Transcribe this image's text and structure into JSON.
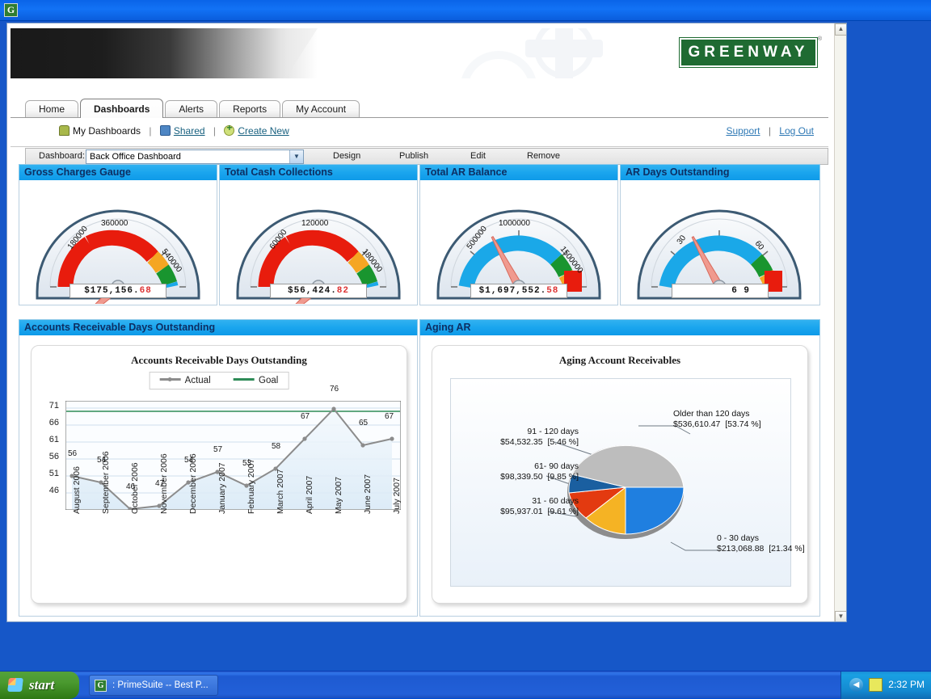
{
  "titlebar": {
    "favicon_letter": "G"
  },
  "banner": {
    "logo_text": "GREENWAY",
    "trademark": "®"
  },
  "tabs": [
    {
      "label": "Home",
      "active": false
    },
    {
      "label": "Dashboards",
      "active": true
    },
    {
      "label": "Alerts",
      "active": false
    },
    {
      "label": "Reports",
      "active": false
    },
    {
      "label": "My Account",
      "active": false
    }
  ],
  "subnav": {
    "my_dashboards": "My Dashboards",
    "shared": "Shared",
    "create_new": "Create New",
    "separator": "|",
    "support": "Support",
    "log_out": "Log Out"
  },
  "toolbar": {
    "dashboard_label": "Dashboard:",
    "selected_dashboard": "Back Office Dashboard",
    "chevron": "▼",
    "design": "Design",
    "publish": "Publish",
    "edit": "Edit",
    "remove": "Remove"
  },
  "gauges": [
    {
      "title": "Gross Charges Gauge",
      "value_main": "$175,156.",
      "value_cents": "68",
      "ticks": [
        "180000",
        "360000",
        "540000"
      ],
      "needle_deg": -42,
      "style": "forward",
      "bands": [
        {
          "color": "#e81c0d",
          "from": 0,
          "to": 0.62
        },
        {
          "color": "#f5a623",
          "from": 0.62,
          "to": 0.73
        },
        {
          "color": "#19952f",
          "from": 0.73,
          "to": 0.89
        },
        {
          "color": "#1aa8e8",
          "from": 0.89,
          "to": 1
        }
      ]
    },
    {
      "title": "Total Cash Collections",
      "value_main": "$56,424.",
      "value_cents": "82",
      "ticks": [
        "60000",
        "120000",
        "180000"
      ],
      "needle_deg": -42,
      "style": "forward",
      "bands": [
        {
          "color": "#e81c0d",
          "from": 0,
          "to": 0.62
        },
        {
          "color": "#f5a623",
          "from": 0.62,
          "to": 0.73
        },
        {
          "color": "#19952f",
          "from": 0.73,
          "to": 0.89
        },
        {
          "color": "#1aa8e8",
          "from": 0.89,
          "to": 1
        }
      ]
    },
    {
      "title": "Total AR Balance",
      "value_main": "$1,697,552.",
      "value_cents": "58",
      "ticks": [
        "500000",
        "1000000",
        "1500000"
      ],
      "needle_deg": 62,
      "style": "reverse",
      "bands": [
        {
          "color": "#1aa8e8",
          "from": 0,
          "to": 0.74
        },
        {
          "color": "#19952f",
          "from": 0.74,
          "to": 0.83
        },
        {
          "color": "#f5a623",
          "from": 0.83,
          "to": 0.89
        },
        {
          "color": "#e81c0d",
          "from": 0.89,
          "to": 1
        }
      ]
    },
    {
      "title": "AR Days Outstanding",
      "value_main": "6 9",
      "value_cents": "",
      "ticks": [
        "30",
        "60",
        ""
      ],
      "needle_deg": 62,
      "style": "reverse",
      "bands": [
        {
          "color": "#1aa8e8",
          "from": 0,
          "to": 0.74
        },
        {
          "color": "#19952f",
          "from": 0.74,
          "to": 0.83
        },
        {
          "color": "#f5a623",
          "from": 0.83,
          "to": 0.89
        },
        {
          "color": "#e81c0d",
          "from": 0.89,
          "to": 1
        }
      ]
    }
  ],
  "panels": {
    "ardo_header": "Accounts Receivable Days Outstanding",
    "aging_header": "Aging AR"
  },
  "chart_data": [
    {
      "type": "line",
      "title": "Accounts Receivable Days Outstanding",
      "xlabel": "",
      "ylabel": "",
      "ylim": [
        46,
        78
      ],
      "yticks": [
        46,
        51,
        56,
        61,
        66,
        71
      ],
      "grid": true,
      "legend_position": "top-center",
      "categories": [
        "August 2006",
        "September 2006",
        "October 2006",
        "November 2006",
        "December 2006",
        "January 2007",
        "February 2007",
        "March 2007",
        "April 2007",
        "May 2007",
        "June 2007",
        "July 2007"
      ],
      "series": [
        {
          "name": "Actual",
          "color": "#8c8c8c",
          "values": [
            56,
            54,
            46,
            47,
            54,
            57,
            53,
            58,
            67,
            76,
            65,
            67
          ]
        },
        {
          "name": "Goal",
          "color": "#2e8b57",
          "constant": 70
        }
      ]
    },
    {
      "type": "pie",
      "title": "Aging Account Receivables",
      "legend_position": "callout-labels",
      "slices": [
        {
          "label": "0 - 30 days",
          "amount": "$213,068.88",
          "percent_text": "[21.34 %]",
          "percent": 21.34,
          "color": "#1f7fe0"
        },
        {
          "label": "31 - 60 days",
          "amount": "$95,937.01",
          "percent_text": "[9.61 %]",
          "percent": 9.61,
          "color": "#f5b324"
        },
        {
          "label": "61- 90 days",
          "amount": "$98,339.50",
          "percent_text": "[9.85 %]",
          "percent": 9.85,
          "color": "#e33a10"
        },
        {
          "label": "91 - 120 days",
          "amount": "$54,532.35",
          "percent_text": "[5.46 %]",
          "percent": 5.46,
          "color": "#1a5fa0"
        },
        {
          "label": "Older than 120 days",
          "amount": "$536,610.47",
          "percent_text": "[53.74 %]",
          "percent": 53.74,
          "color": "#bdbdbd"
        }
      ]
    }
  ],
  "scrollbar": {
    "up": "▲",
    "down": "▼"
  },
  "taskbar": {
    "start_label": "start",
    "task_icon_letter": "G",
    "task_label": ": PrimeSuite -- Best P...",
    "tray_arrow": "◀",
    "clock": "2:32 PM"
  }
}
